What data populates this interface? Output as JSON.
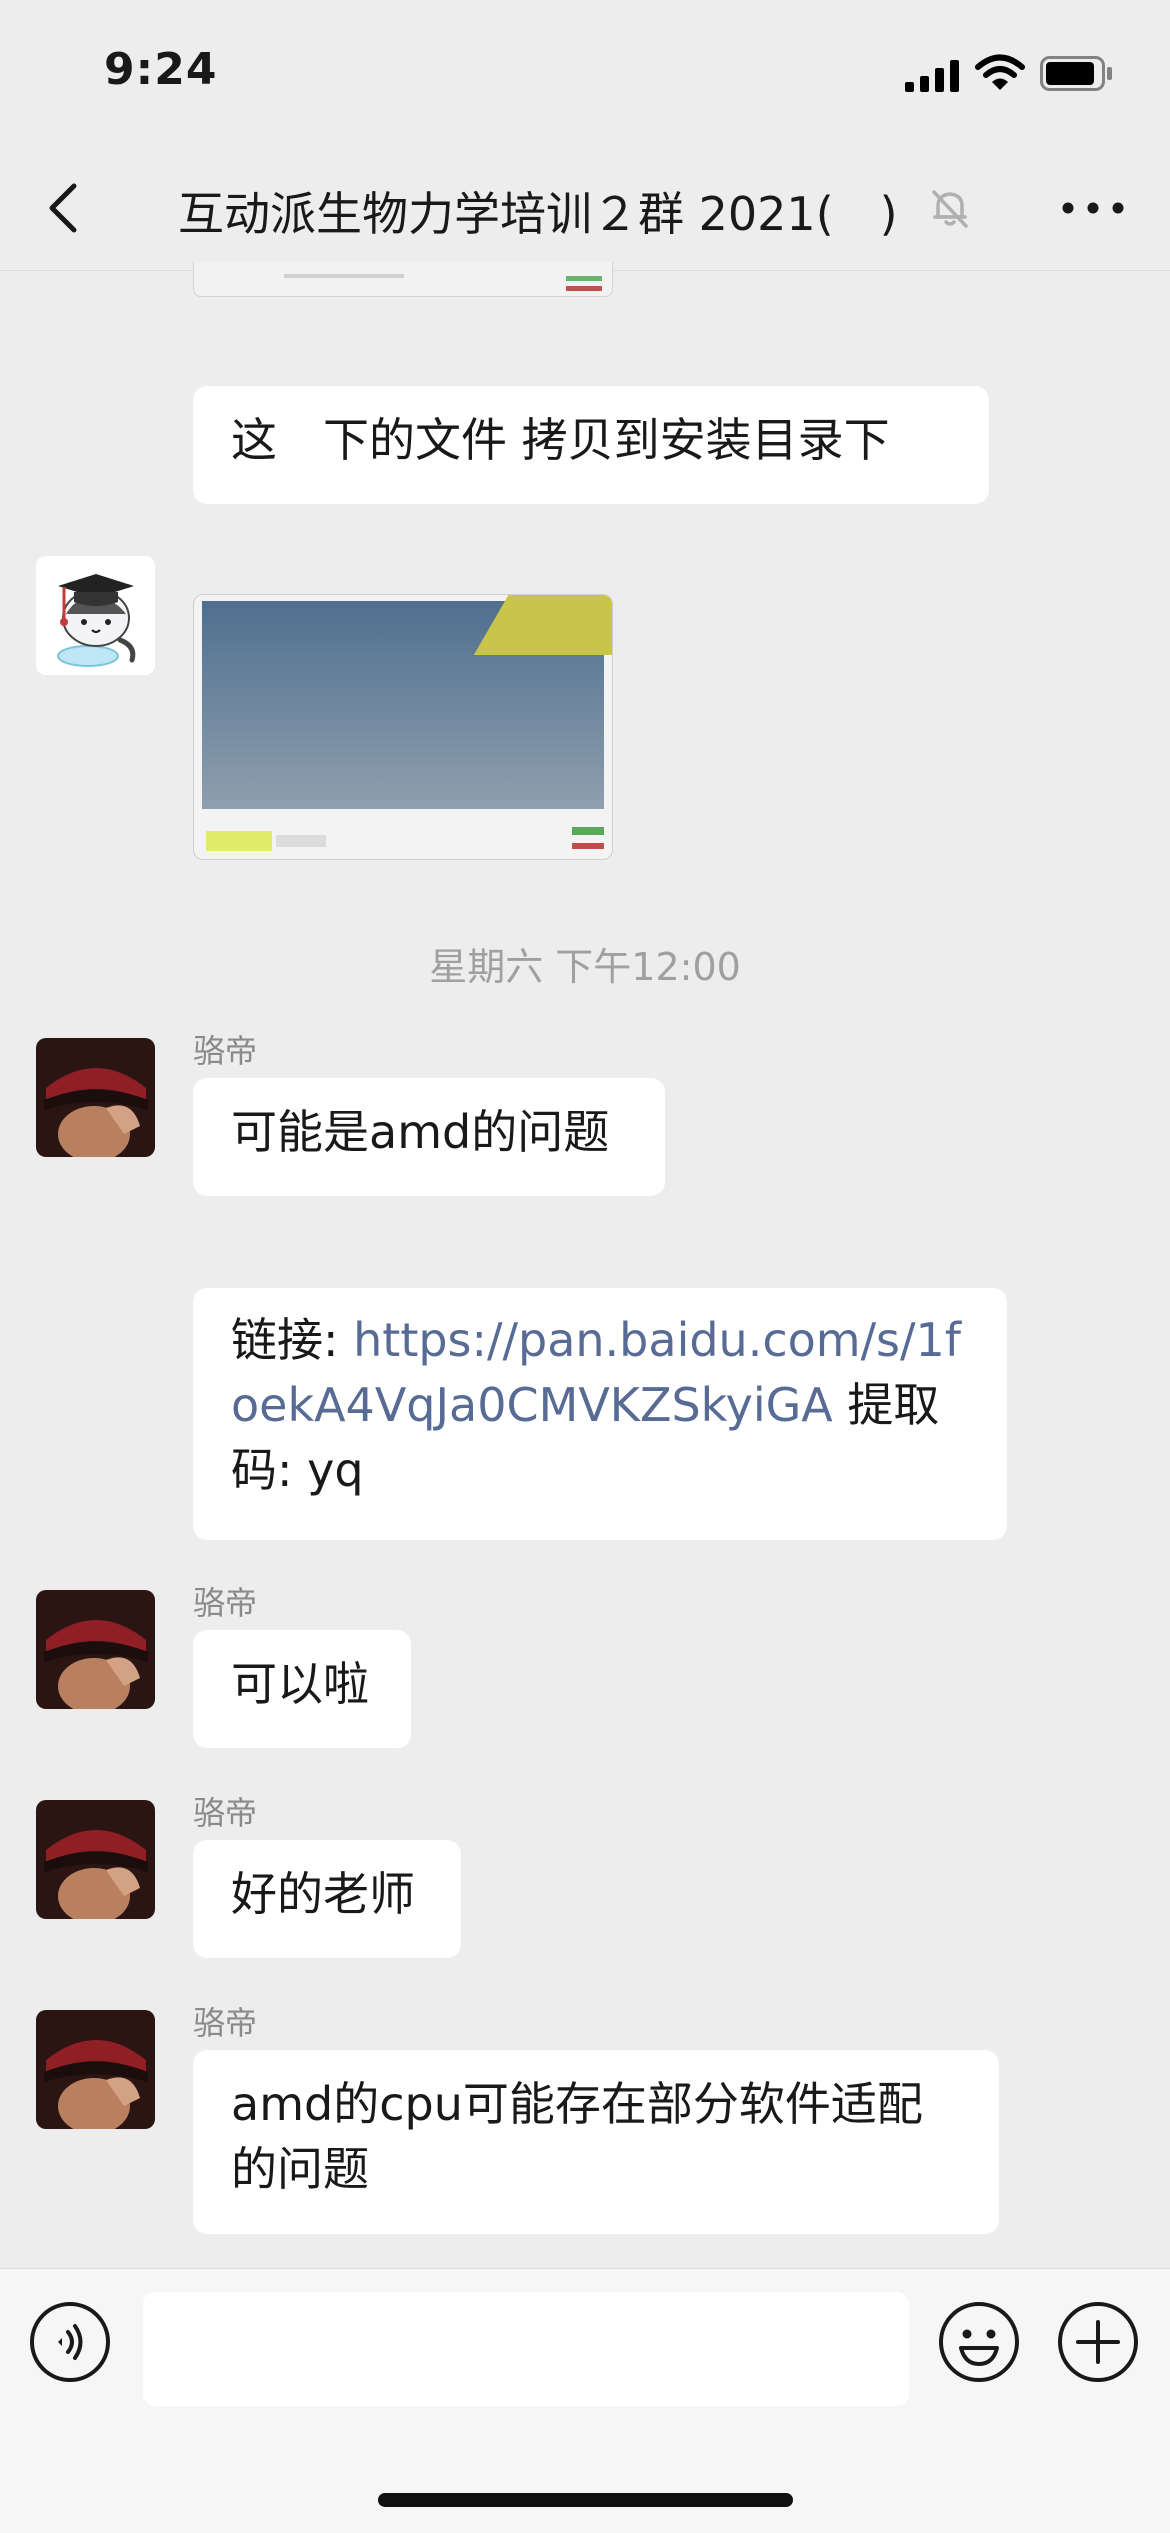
{
  "status_bar": {
    "time": "9:24"
  },
  "header": {
    "title": "互动派生物力学培训２群 2021(　)"
  },
  "messages": {
    "m1": {
      "text": "这　下的文件  拷贝到安装目录下"
    },
    "time_divider": "星期六 下午12:00",
    "m3": {
      "sender": "骆帝",
      "text": "可能是amd的问题"
    },
    "m4": {
      "prefix": "链接: ",
      "link": "https://pan.baidu.com/s/1foekA4VqJa0CMVKZSkyiGA",
      "suffix": " 提取码: yq"
    },
    "m5": {
      "sender": "骆帝",
      "text": "可以啦"
    },
    "m6": {
      "sender": "骆帝",
      "text": "好的老师"
    },
    "m7": {
      "sender": "骆帝",
      "text": "amd的cpu可能存在部分软件适配的问题"
    }
  },
  "input": {
    "placeholder": ""
  },
  "colors": {
    "background": "#ededed",
    "bubble": "#ffffff",
    "link": "#576b95",
    "meta_text": "#8a8a8a"
  }
}
